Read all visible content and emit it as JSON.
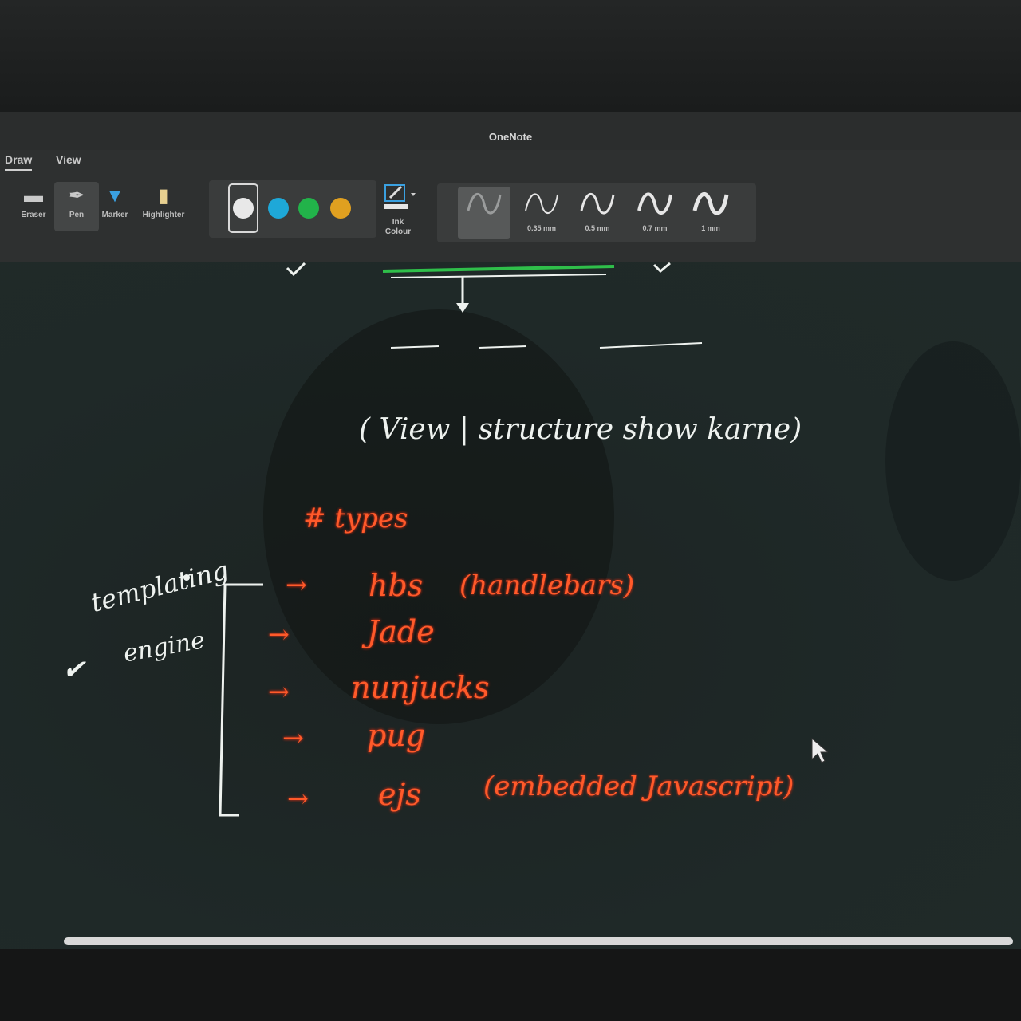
{
  "app": {
    "title": "OneNote",
    "tabs": [
      {
        "label": "Draw",
        "active": true
      },
      {
        "label": "View",
        "active": false
      }
    ]
  },
  "ribbon": {
    "tools": [
      {
        "label": "Eraser",
        "icon": "eraser-icon"
      },
      {
        "label": "Pen",
        "icon": "pen-icon",
        "selected": true
      },
      {
        "label": "Marker",
        "icon": "marker-icon"
      },
      {
        "label": "Highlighter",
        "icon": "highlighter-icon"
      }
    ],
    "colors": [
      "#e8e8e8",
      "#1ea8d8",
      "#22b34a",
      "#e0a020"
    ],
    "selected_color": "#e8e8e8",
    "ink_colour_label_1": "Ink",
    "ink_colour_label_2": "Colour",
    "thicknesses": [
      {
        "label": "",
        "selected": true
      },
      {
        "label": "0.35 mm"
      },
      {
        "label": "0.5 mm"
      },
      {
        "label": "0.7 mm"
      },
      {
        "label": "1 mm"
      }
    ]
  },
  "notes": {
    "header_text": "( View | structure show karne)",
    "types_heading": "# types",
    "bracket_label_1": "templating",
    "bracket_label_2": "engine",
    "engines": [
      {
        "arrow": "→",
        "name": "hbs",
        "note": "(handlebars)"
      },
      {
        "arrow": "→",
        "name": "Jade",
        "note": ""
      },
      {
        "arrow": "→",
        "name": "nunjucks",
        "note": ""
      },
      {
        "arrow": "→",
        "name": "pug",
        "note": ""
      },
      {
        "arrow": "→",
        "name": "ejs",
        "note": "(embedded Javascript)"
      }
    ],
    "check_mark": "✔"
  },
  "colors": {
    "ink_white": "#eef2ef",
    "ink_red": "#ff5a2a",
    "ink_green": "#2fbf4a"
  }
}
